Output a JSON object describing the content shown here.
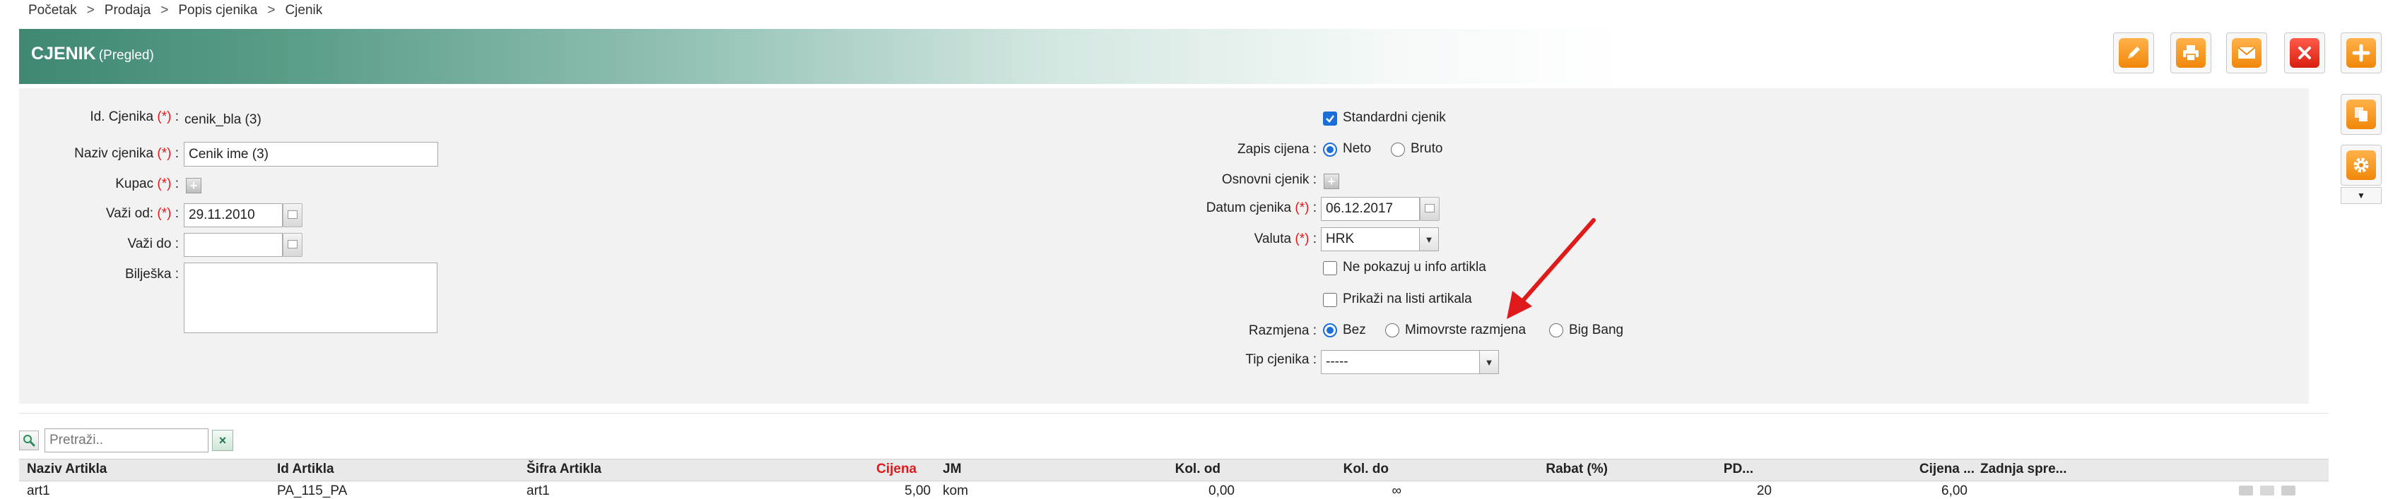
{
  "breadcrumb": [
    "Početak",
    "Prodaja",
    "Popis cjenika",
    "Cjenik"
  ],
  "breadcrumb_separator": ">",
  "header": {
    "title": "CJENIK",
    "subtitle": "(Pregled)"
  },
  "toolbar": {
    "buttons": [
      {
        "name": "edit-button",
        "icon": "pencil-icon"
      },
      {
        "name": "print-button",
        "icon": "printer-icon"
      },
      {
        "name": "email-button",
        "icon": "envelope-icon"
      },
      {
        "name": "delete-button",
        "icon": "close-icon"
      },
      {
        "name": "add-button",
        "icon": "plus-icon"
      }
    ],
    "side_buttons": [
      {
        "name": "copy-button",
        "icon": "copy-icon"
      },
      {
        "name": "settings-button",
        "icon": "gear-icon"
      }
    ]
  },
  "required_mark": "(*)",
  "form": {
    "id": {
      "label": "Id. Cjenika",
      "value": "cenik_bla (3)"
    },
    "naziv": {
      "label": "Naziv cjenika",
      "value": "Cenik ime (3)"
    },
    "kupac": {
      "label": "Kupac"
    },
    "vazi_od": {
      "label": "Važi od:",
      "value": "29.11.2010"
    },
    "vazi_do": {
      "label": "Važi do",
      "value": ""
    },
    "biljeska": {
      "label": "Bilješka",
      "value": ""
    },
    "standardni": {
      "label": "Standardni cjenik",
      "checked": true
    },
    "zapis": {
      "label": "Zapis cijena",
      "options": [
        "Neto",
        "Bruto"
      ],
      "selected": "Neto"
    },
    "osnovni": {
      "label": "Osnovni cjenik"
    },
    "datum": {
      "label": "Datum cjenika",
      "value": "06.12.2017"
    },
    "valuta": {
      "label": "Valuta",
      "value": "HRK"
    },
    "ne_pokazuj": {
      "label": "Ne pokazuj u info artikla",
      "checked": false
    },
    "prikazi": {
      "label": "Prikaži na listi artikala",
      "checked": false
    },
    "razmjena": {
      "label": "Razmjena",
      "options": [
        "Bez",
        "Mimovrste razmjena",
        "Big Bang"
      ],
      "selected": "Bez"
    },
    "tip": {
      "label": "Tip cjenika",
      "value": "-----"
    }
  },
  "grid": {
    "search_placeholder": "Pretraži..",
    "clear_label": "×",
    "columns": [
      "Naziv Artikla",
      "Id Artikla",
      "Šifra Artikla",
      "Cijena",
      "JM",
      "Kol. od",
      "Kol. do",
      "Rabat (%)",
      "PD...",
      "Cijena ...",
      "Zadnja spre..."
    ],
    "rows": [
      [
        "art1",
        "PA_115_PA",
        "art1",
        "5,00",
        "kom",
        "0,00",
        "∞",
        "",
        "20",
        "6,00",
        ""
      ]
    ]
  },
  "colors": {
    "header_start": "#3f8872",
    "required": "#e01a1a",
    "cijena_header": "#e01a1a",
    "arrow": "#e01a1a",
    "accent_button": "#f0870a",
    "danger_button": "#d8200f"
  }
}
